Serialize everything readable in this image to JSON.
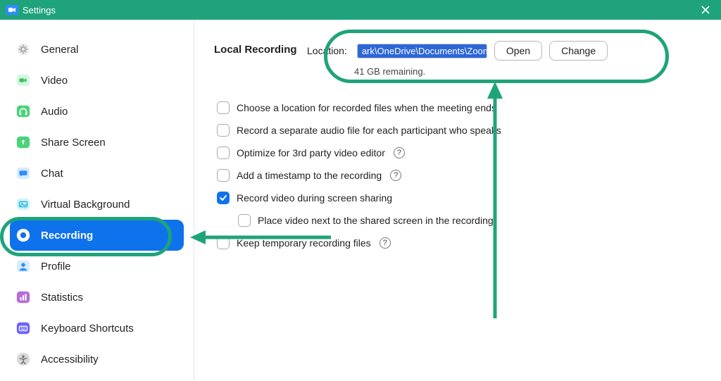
{
  "window": {
    "title": "Settings"
  },
  "sidebar": {
    "items": [
      {
        "label": "General",
        "icon": "gear"
      },
      {
        "label": "Video",
        "icon": "video"
      },
      {
        "label": "Audio",
        "icon": "audio"
      },
      {
        "label": "Share Screen",
        "icon": "share"
      },
      {
        "label": "Chat",
        "icon": "chat"
      },
      {
        "label": "Virtual Background",
        "icon": "vb"
      },
      {
        "label": "Recording",
        "icon": "record",
        "active": true
      },
      {
        "label": "Profile",
        "icon": "profile"
      },
      {
        "label": "Statistics",
        "icon": "stats"
      },
      {
        "label": "Keyboard Shortcuts",
        "icon": "keyboard"
      },
      {
        "label": "Accessibility",
        "icon": "accessibility"
      }
    ]
  },
  "recording": {
    "section_label": "Local Recording",
    "location_label": "Location:",
    "path": "ark\\OneDrive\\Documents\\Zoom",
    "open_btn": "Open",
    "change_btn": "Change",
    "remaining": "41 GB remaining.",
    "options": [
      {
        "label": "Choose a location for recorded files when the meeting ends",
        "checked": false
      },
      {
        "label": "Record a separate audio file for each participant who speaks",
        "checked": false
      },
      {
        "label": "Optimize for 3rd party video editor",
        "checked": false,
        "help": true
      },
      {
        "label": "Add a timestamp to the recording",
        "checked": false,
        "help": true
      },
      {
        "label": "Record video during screen sharing",
        "checked": true
      },
      {
        "label": "Place video next to the shared screen in the recording",
        "checked": false,
        "indent": true
      },
      {
        "label": "Keep temporary recording files",
        "checked": false,
        "help": true
      }
    ]
  },
  "colors": {
    "accent": "#0e72ed",
    "annotation": "#1fa37a",
    "titlebar": "#1fa37a"
  }
}
